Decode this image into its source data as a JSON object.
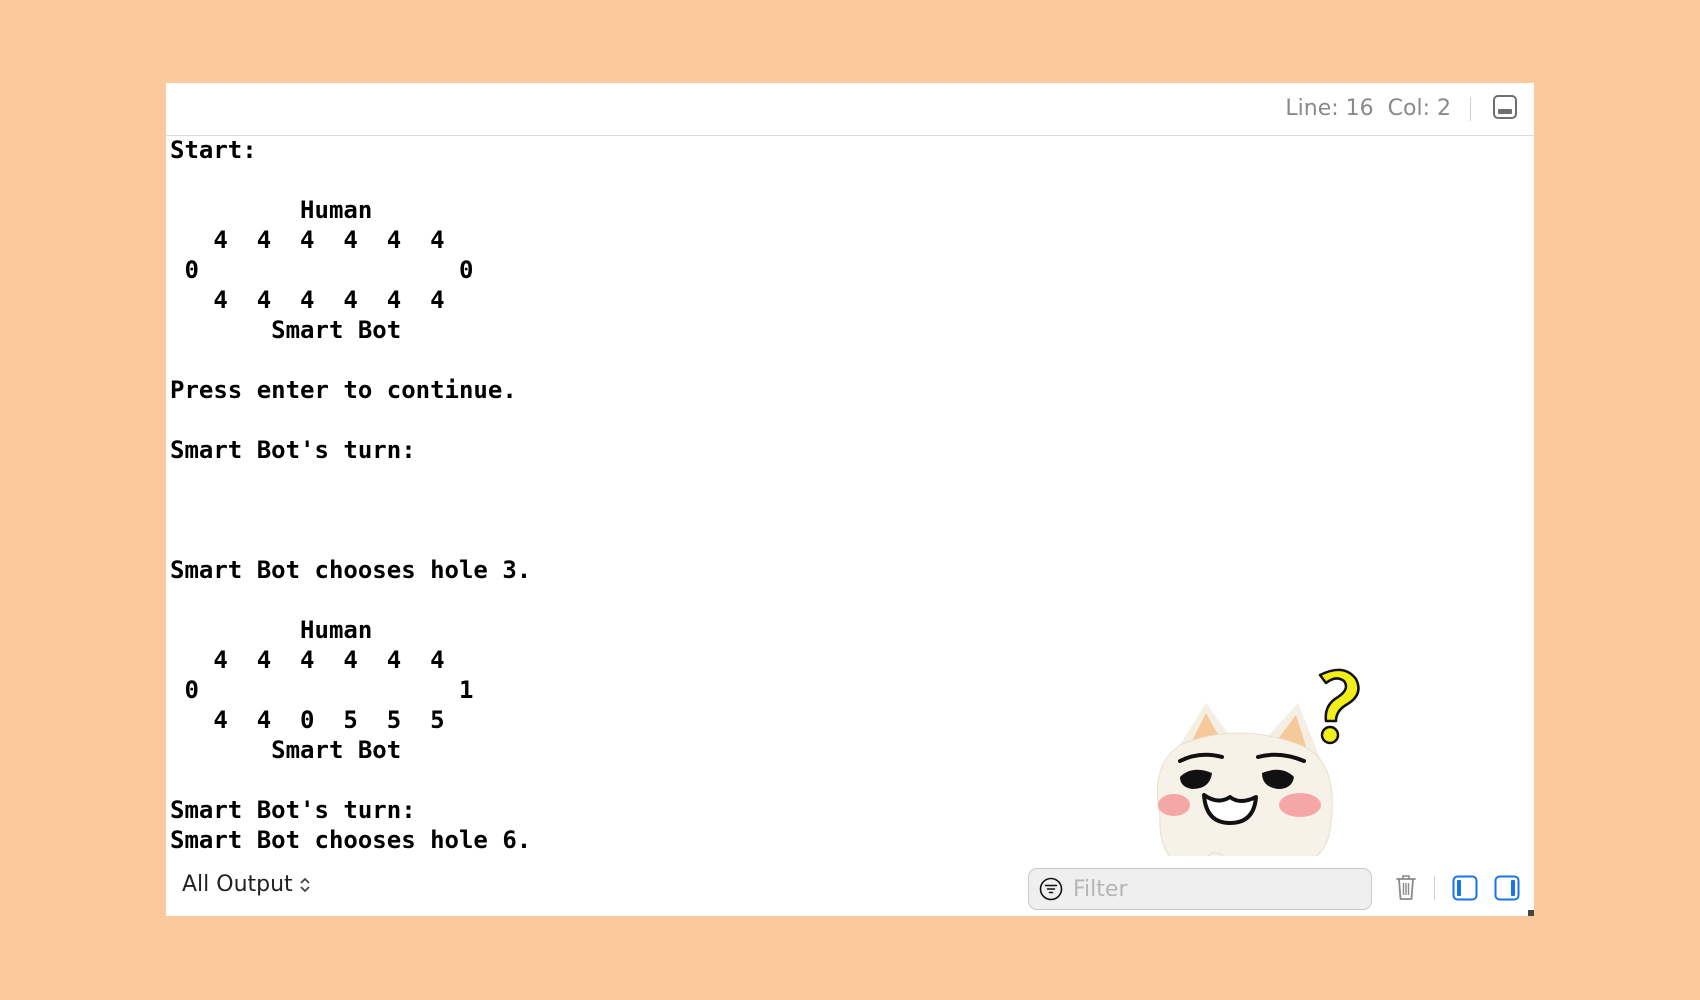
{
  "topbar": {
    "line_label": "Line: 16",
    "col_label": "Col: 2"
  },
  "console_lines": [
    "Start:",
    "",
    "         Human",
    "   4  4  4  4  4  4",
    " 0                  0",
    "   4  4  4  4  4  4",
    "       Smart Bot",
    "",
    "Press enter to continue.",
    "",
    "Smart Bot's turn:",
    "",
    "",
    "",
    "Smart Bot chooses hole 3.",
    "",
    "         Human",
    "   4  4  4  4  4  4",
    " 0                  1",
    "   4  4  0  5  5  5",
    "       Smart Bot",
    "",
    "Smart Bot's turn:",
    "Smart Bot chooses hole 6."
  ],
  "bottombar": {
    "scope_label": "All Output",
    "filter_placeholder": "Filter",
    "filter_value": ""
  },
  "icons": {
    "panel_toggle": "bottom-panel-icon",
    "filter": "filter-icon",
    "trash": "trash-icon",
    "pane_left": "left-pane-icon",
    "pane_right": "right-pane-icon",
    "mascot": "thinking-cat-mascot"
  },
  "colors": {
    "background": "#fcc99c",
    "window": "#ffffff",
    "accent": "#1a73e8",
    "question_mark": "#f2ee1a"
  }
}
